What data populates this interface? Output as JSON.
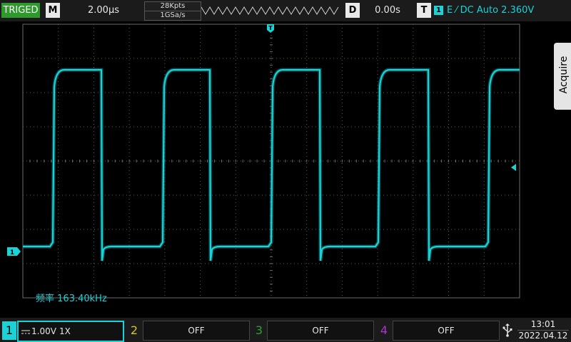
{
  "topbar": {
    "trigger_status": "TRIGED",
    "mode_button": "M",
    "timebase": "2.00μs",
    "memory_depth": "28Kpts",
    "sample_rate": "1GSa/s",
    "delay_button": "D",
    "delay": "0.00s",
    "trigger_button": "T",
    "trigger_channel": "1",
    "trigger_info": "E ⁄ DC Auto 2.360V"
  },
  "screen": {
    "trigger_pos_marker": "T",
    "ch1_ground_marker": "1",
    "frequency_label": "频率",
    "frequency_value": "163.40kHz",
    "menu_tab": "Acquire"
  },
  "bottombar": {
    "channels": [
      {
        "number": "1",
        "coupling_icon": "dc-coupling-icon",
        "scale": "1.00V",
        "probe": "1X",
        "color": "#19d3d7"
      },
      {
        "number": "2",
        "state": "OFF",
        "color": "#e0c020"
      },
      {
        "number": "3",
        "state": "OFF",
        "color": "#2ea02e"
      },
      {
        "number": "4",
        "state": "OFF",
        "color": "#b030d0"
      }
    ],
    "time": "13:01",
    "date": "2022.04.12"
  },
  "trace_color": "#19d3d7"
}
